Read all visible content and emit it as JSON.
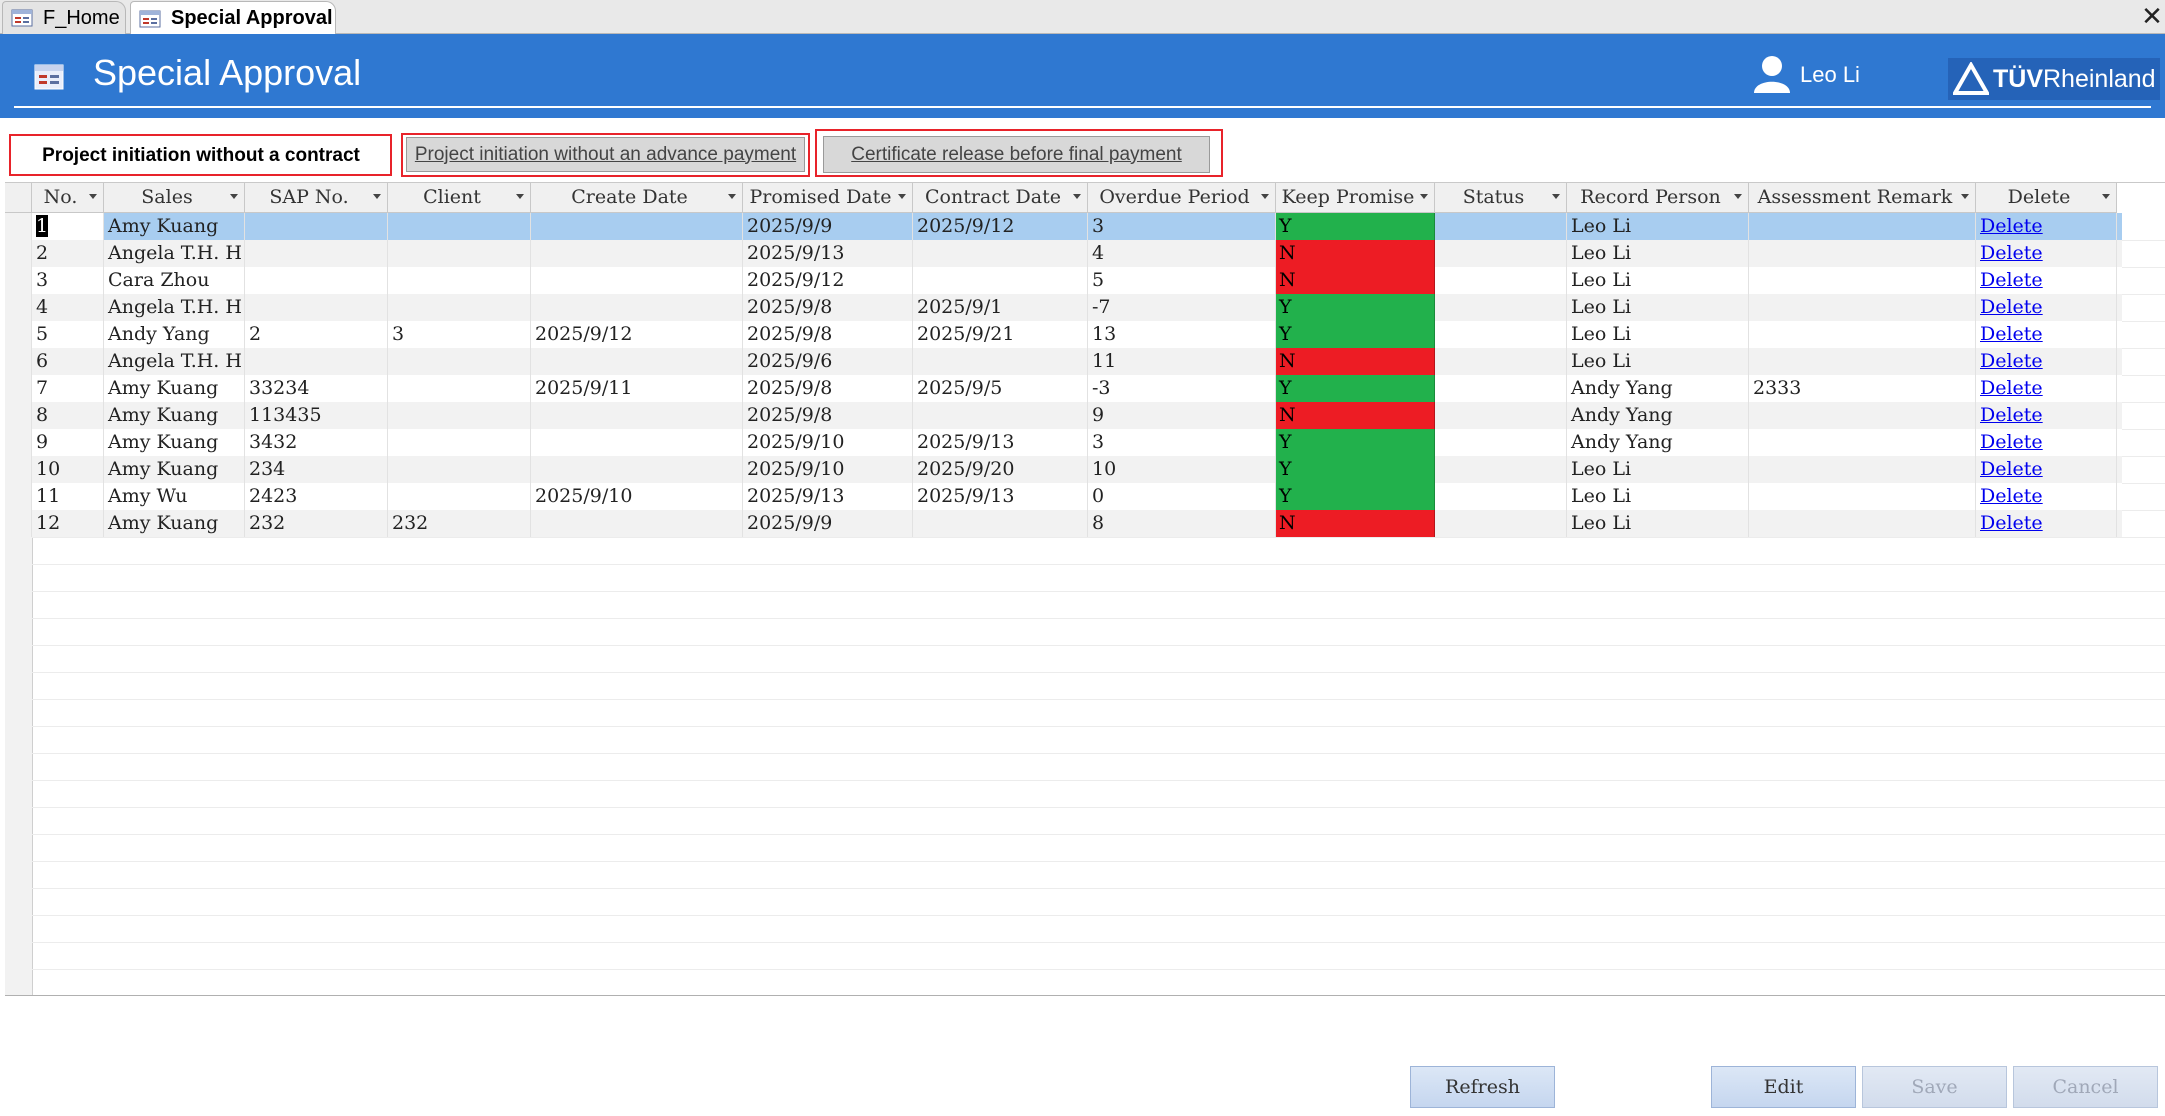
{
  "doc_tabs": [
    {
      "label": "F_Home"
    },
    {
      "label": "Special Approval"
    }
  ],
  "close_glyph": "✕",
  "header": {
    "title": "Special Approval",
    "user": "Leo Li",
    "logo_brand": "TÜV",
    "logo_name": "Rheinland",
    "background_color": "#2f78d1"
  },
  "tab_buttons": [
    {
      "label": "Project initiation without a contract",
      "active": true
    },
    {
      "label": "Project initiation without an advance payment",
      "active": false
    },
    {
      "label": "Certificate release before final payment",
      "active": false
    }
  ],
  "grid": {
    "columns": [
      "No.",
      "Sales",
      "SAP No.",
      "Client",
      "Create Date",
      "Promised Date",
      "Contract Date",
      "Overdue Period",
      "Keep Promise",
      "Status",
      "Record Person",
      "Assessment Remark",
      "Delete"
    ],
    "rows": [
      {
        "no": "1",
        "sales": "Amy Kuang",
        "sap": "",
        "client": "",
        "create": "",
        "promised": "2025/9/9",
        "contract": "2025/9/12",
        "overdue": "3",
        "keep": "Y",
        "status": "",
        "person": "Leo Li",
        "remark": "",
        "delete": "Delete"
      },
      {
        "no": "2",
        "sales": "Angela T.H. H",
        "sap": "",
        "client": "",
        "create": "",
        "promised": "2025/9/13",
        "contract": "",
        "overdue": "4",
        "keep": "N",
        "status": "",
        "person": "Leo Li",
        "remark": "",
        "delete": "Delete"
      },
      {
        "no": "3",
        "sales": "Cara Zhou",
        "sap": "",
        "client": "",
        "create": "",
        "promised": "2025/9/12",
        "contract": "",
        "overdue": "5",
        "keep": "N",
        "status": "",
        "person": "Leo Li",
        "remark": "",
        "delete": "Delete"
      },
      {
        "no": "4",
        "sales": "Angela T.H. H",
        "sap": "",
        "client": "",
        "create": "",
        "promised": "2025/9/8",
        "contract": "2025/9/1",
        "overdue": "-7",
        "keep": "Y",
        "status": "",
        "person": "Leo Li",
        "remark": "",
        "delete": "Delete"
      },
      {
        "no": "5",
        "sales": "Andy Yang",
        "sap": "2",
        "client": "3",
        "create": "2025/9/12",
        "promised": "2025/9/8",
        "contract": "2025/9/21",
        "overdue": "13",
        "keep": "Y",
        "status": "",
        "person": "Leo Li",
        "remark": "",
        "delete": "Delete"
      },
      {
        "no": "6",
        "sales": "Angela T.H. H",
        "sap": "",
        "client": "",
        "create": "",
        "promised": "2025/9/6",
        "contract": "",
        "overdue": "11",
        "keep": "N",
        "status": "",
        "person": "Leo Li",
        "remark": "",
        "delete": "Delete"
      },
      {
        "no": "7",
        "sales": "Amy Kuang",
        "sap": "33234",
        "client": "",
        "create": "2025/9/11",
        "promised": "2025/9/8",
        "contract": "2025/9/5",
        "overdue": "-3",
        "keep": "Y",
        "status": "",
        "person": "Andy Yang",
        "remark": "2333",
        "delete": "Delete"
      },
      {
        "no": "8",
        "sales": "Amy Kuang",
        "sap": "113435",
        "client": "",
        "create": "",
        "promised": "2025/9/8",
        "contract": "",
        "overdue": "9",
        "keep": "N",
        "status": "",
        "person": "Andy Yang",
        "remark": "",
        "delete": "Delete"
      },
      {
        "no": "9",
        "sales": "Amy Kuang",
        "sap": "3432",
        "client": "",
        "create": "",
        "promised": "2025/9/10",
        "contract": "2025/9/13",
        "overdue": "3",
        "keep": "Y",
        "status": "",
        "person": "Andy Yang",
        "remark": "",
        "delete": "Delete"
      },
      {
        "no": "10",
        "sales": "Amy Kuang",
        "sap": "234",
        "client": "",
        "create": "",
        "promised": "2025/9/10",
        "contract": "2025/9/20",
        "overdue": "10",
        "keep": "Y",
        "status": "",
        "person": "Leo Li",
        "remark": "",
        "delete": "Delete"
      },
      {
        "no": "11",
        "sales": "Amy Wu",
        "sap": "2423",
        "client": "",
        "create": "2025/9/10",
        "promised": "2025/9/13",
        "contract": "2025/9/13",
        "overdue": "0",
        "keep": "Y",
        "status": "",
        "person": "Leo Li",
        "remark": "",
        "delete": "Delete"
      },
      {
        "no": "12",
        "sales": "Amy Kuang",
        "sap": "232",
        "client": "232",
        "create": "",
        "promised": "2025/9/9",
        "contract": "",
        "overdue": "8",
        "keep": "N",
        "status": "",
        "person": "Leo Li",
        "remark": "",
        "delete": "Delete"
      }
    ],
    "selected_row": 0,
    "colors": {
      "keep_yes": "#22b14c",
      "keep_no": "#ed1c24",
      "selected": "#a8cdf0",
      "alt_row": "#f2f2f2"
    }
  },
  "footer_buttons": {
    "refresh": "Refresh",
    "edit": "Edit",
    "save": "Save",
    "cancel": "Cancel"
  }
}
